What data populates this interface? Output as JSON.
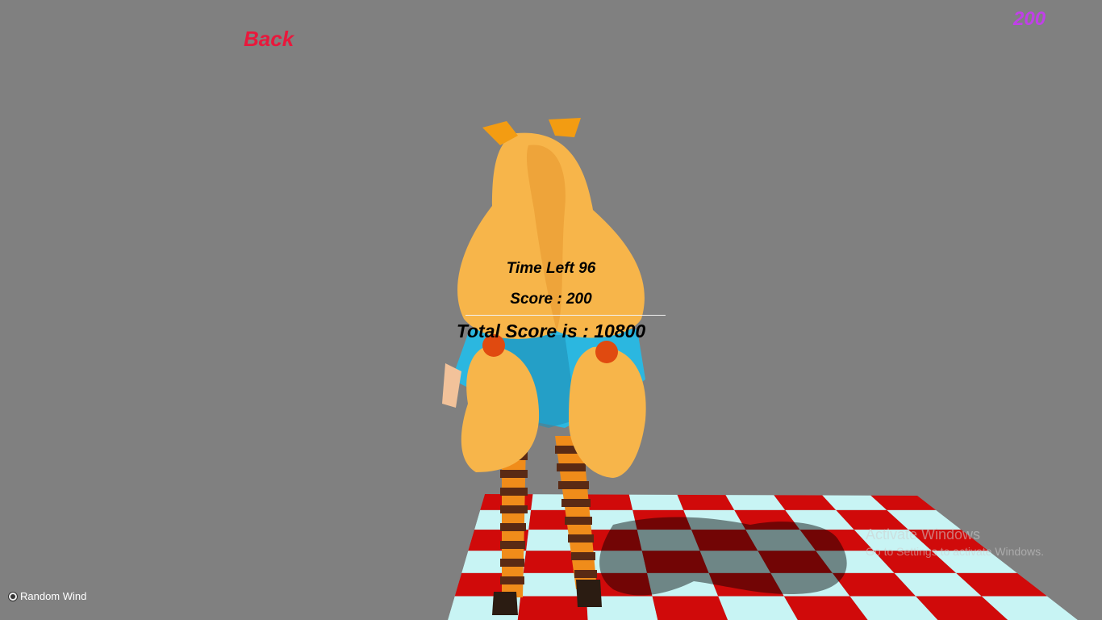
{
  "hud": {
    "back_label": "Back",
    "corner_score": "200",
    "time_left": "Time Left  96",
    "score": "Score :  200",
    "total_score": "Total Score is : 10800"
  },
  "controls": {
    "random_wind_label": "Random Wind",
    "random_wind_selected": true
  },
  "watermark": {
    "title": "Activate Windows",
    "subtitle": "Go to Settings to activate Windows."
  },
  "colors": {
    "background": "#808080",
    "back_text": "#e8183c",
    "corner_score_text": "#c040e8",
    "floor_red": "#d00a0a",
    "floor_cyan": "#c8f4f4",
    "hair": "#f7b54a",
    "dress": "#2bb7e0"
  },
  "icons": {
    "wind_toggle": "radio-button-icon"
  }
}
